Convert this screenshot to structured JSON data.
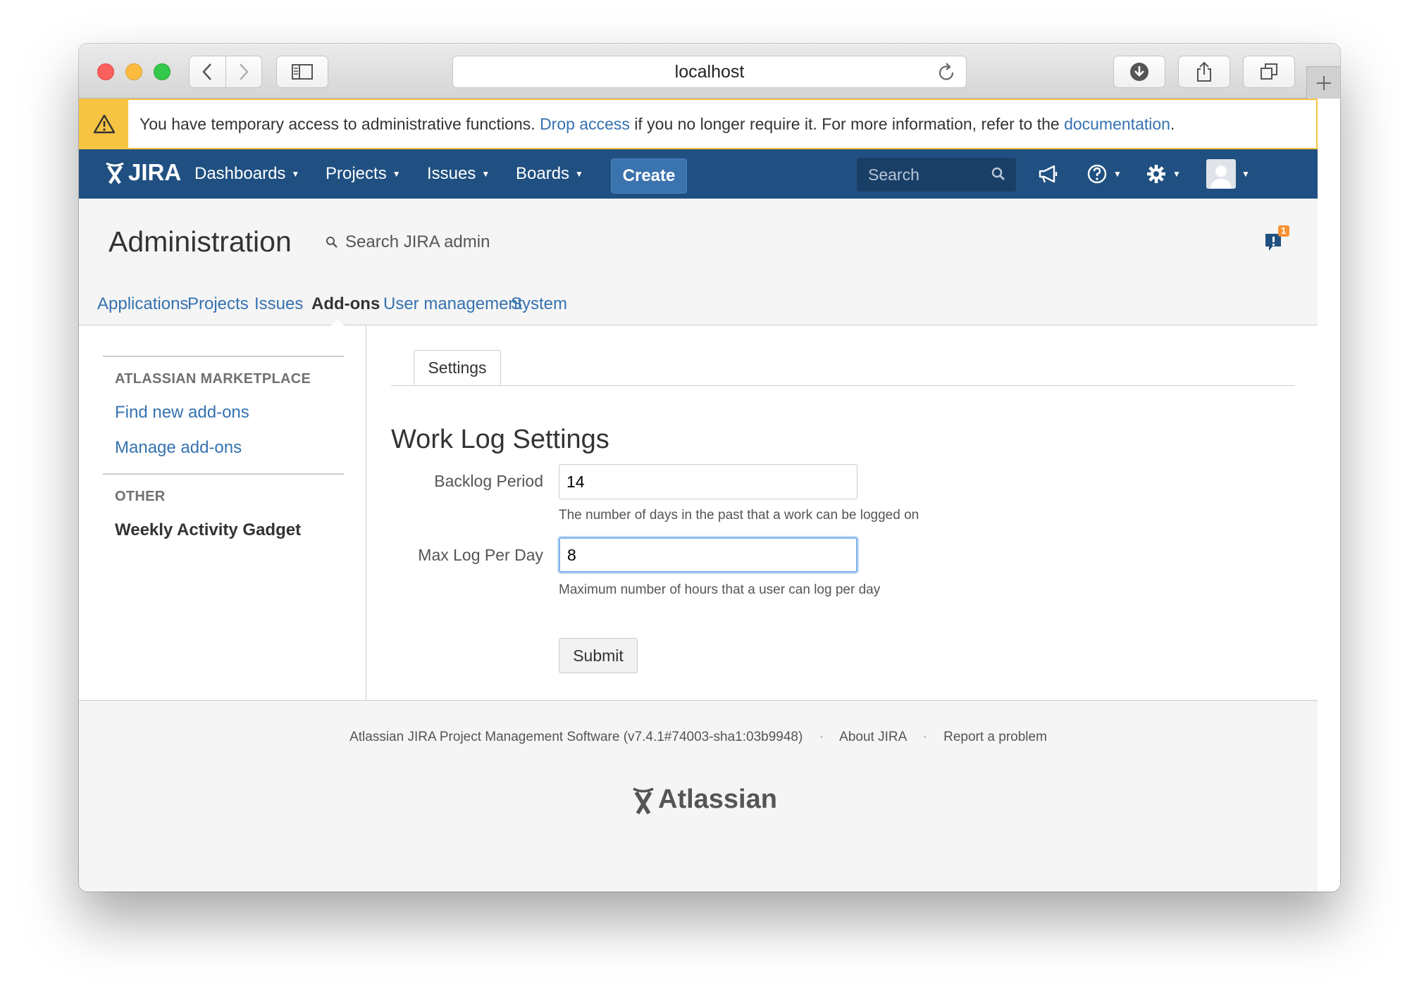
{
  "browser": {
    "url": "localhost"
  },
  "banner": {
    "text_before": "You have temporary access to administrative functions.",
    "drop_access": "Drop access",
    "text_middle": "if you no longer require it. For more information, refer to the",
    "documentation": "documentation",
    "text_end": "."
  },
  "header": {
    "logo": "JIRA",
    "nav": [
      "Dashboards",
      "Projects",
      "Issues",
      "Boards"
    ],
    "create_label": "Create",
    "search_placeholder": "Search"
  },
  "admin": {
    "title": "Administration",
    "search_placeholder": "Search JIRA admin",
    "feedback_count": "1",
    "tabs": [
      "Applications",
      "Projects",
      "Issues",
      "Add-ons",
      "User management",
      "System"
    ],
    "active_tab": "Add-ons"
  },
  "sidebar": {
    "sections": [
      {
        "heading": "ATLASSIAN MARKETPLACE",
        "items": [
          "Find new add-ons",
          "Manage add-ons"
        ]
      },
      {
        "heading": "OTHER",
        "items": [
          "Weekly Activity Gadget"
        ]
      }
    ],
    "active_item": "Weekly Activity Gadget"
  },
  "main": {
    "tab_label": "Settings",
    "title": "Work Log Settings",
    "fields": [
      {
        "label": "Backlog Period",
        "value": "14",
        "description": "The number of days in the past that a work can be logged on"
      },
      {
        "label": "Max Log Per Day",
        "value": "8",
        "description": "Maximum number of hours that a user can log per day"
      }
    ],
    "submit_label": "Submit"
  },
  "footer": {
    "version": "Atlassian JIRA Project Management Software (v7.4.1#74003-sha1:03b9948)",
    "about": "About JIRA",
    "report": "Report a problem",
    "sep": "·",
    "logo": "Atlassian"
  },
  "colors": {
    "header_bg": "#205081",
    "link": "#3572b0",
    "create_bg": "#3b73af",
    "banner_warn": "#f6c342"
  }
}
